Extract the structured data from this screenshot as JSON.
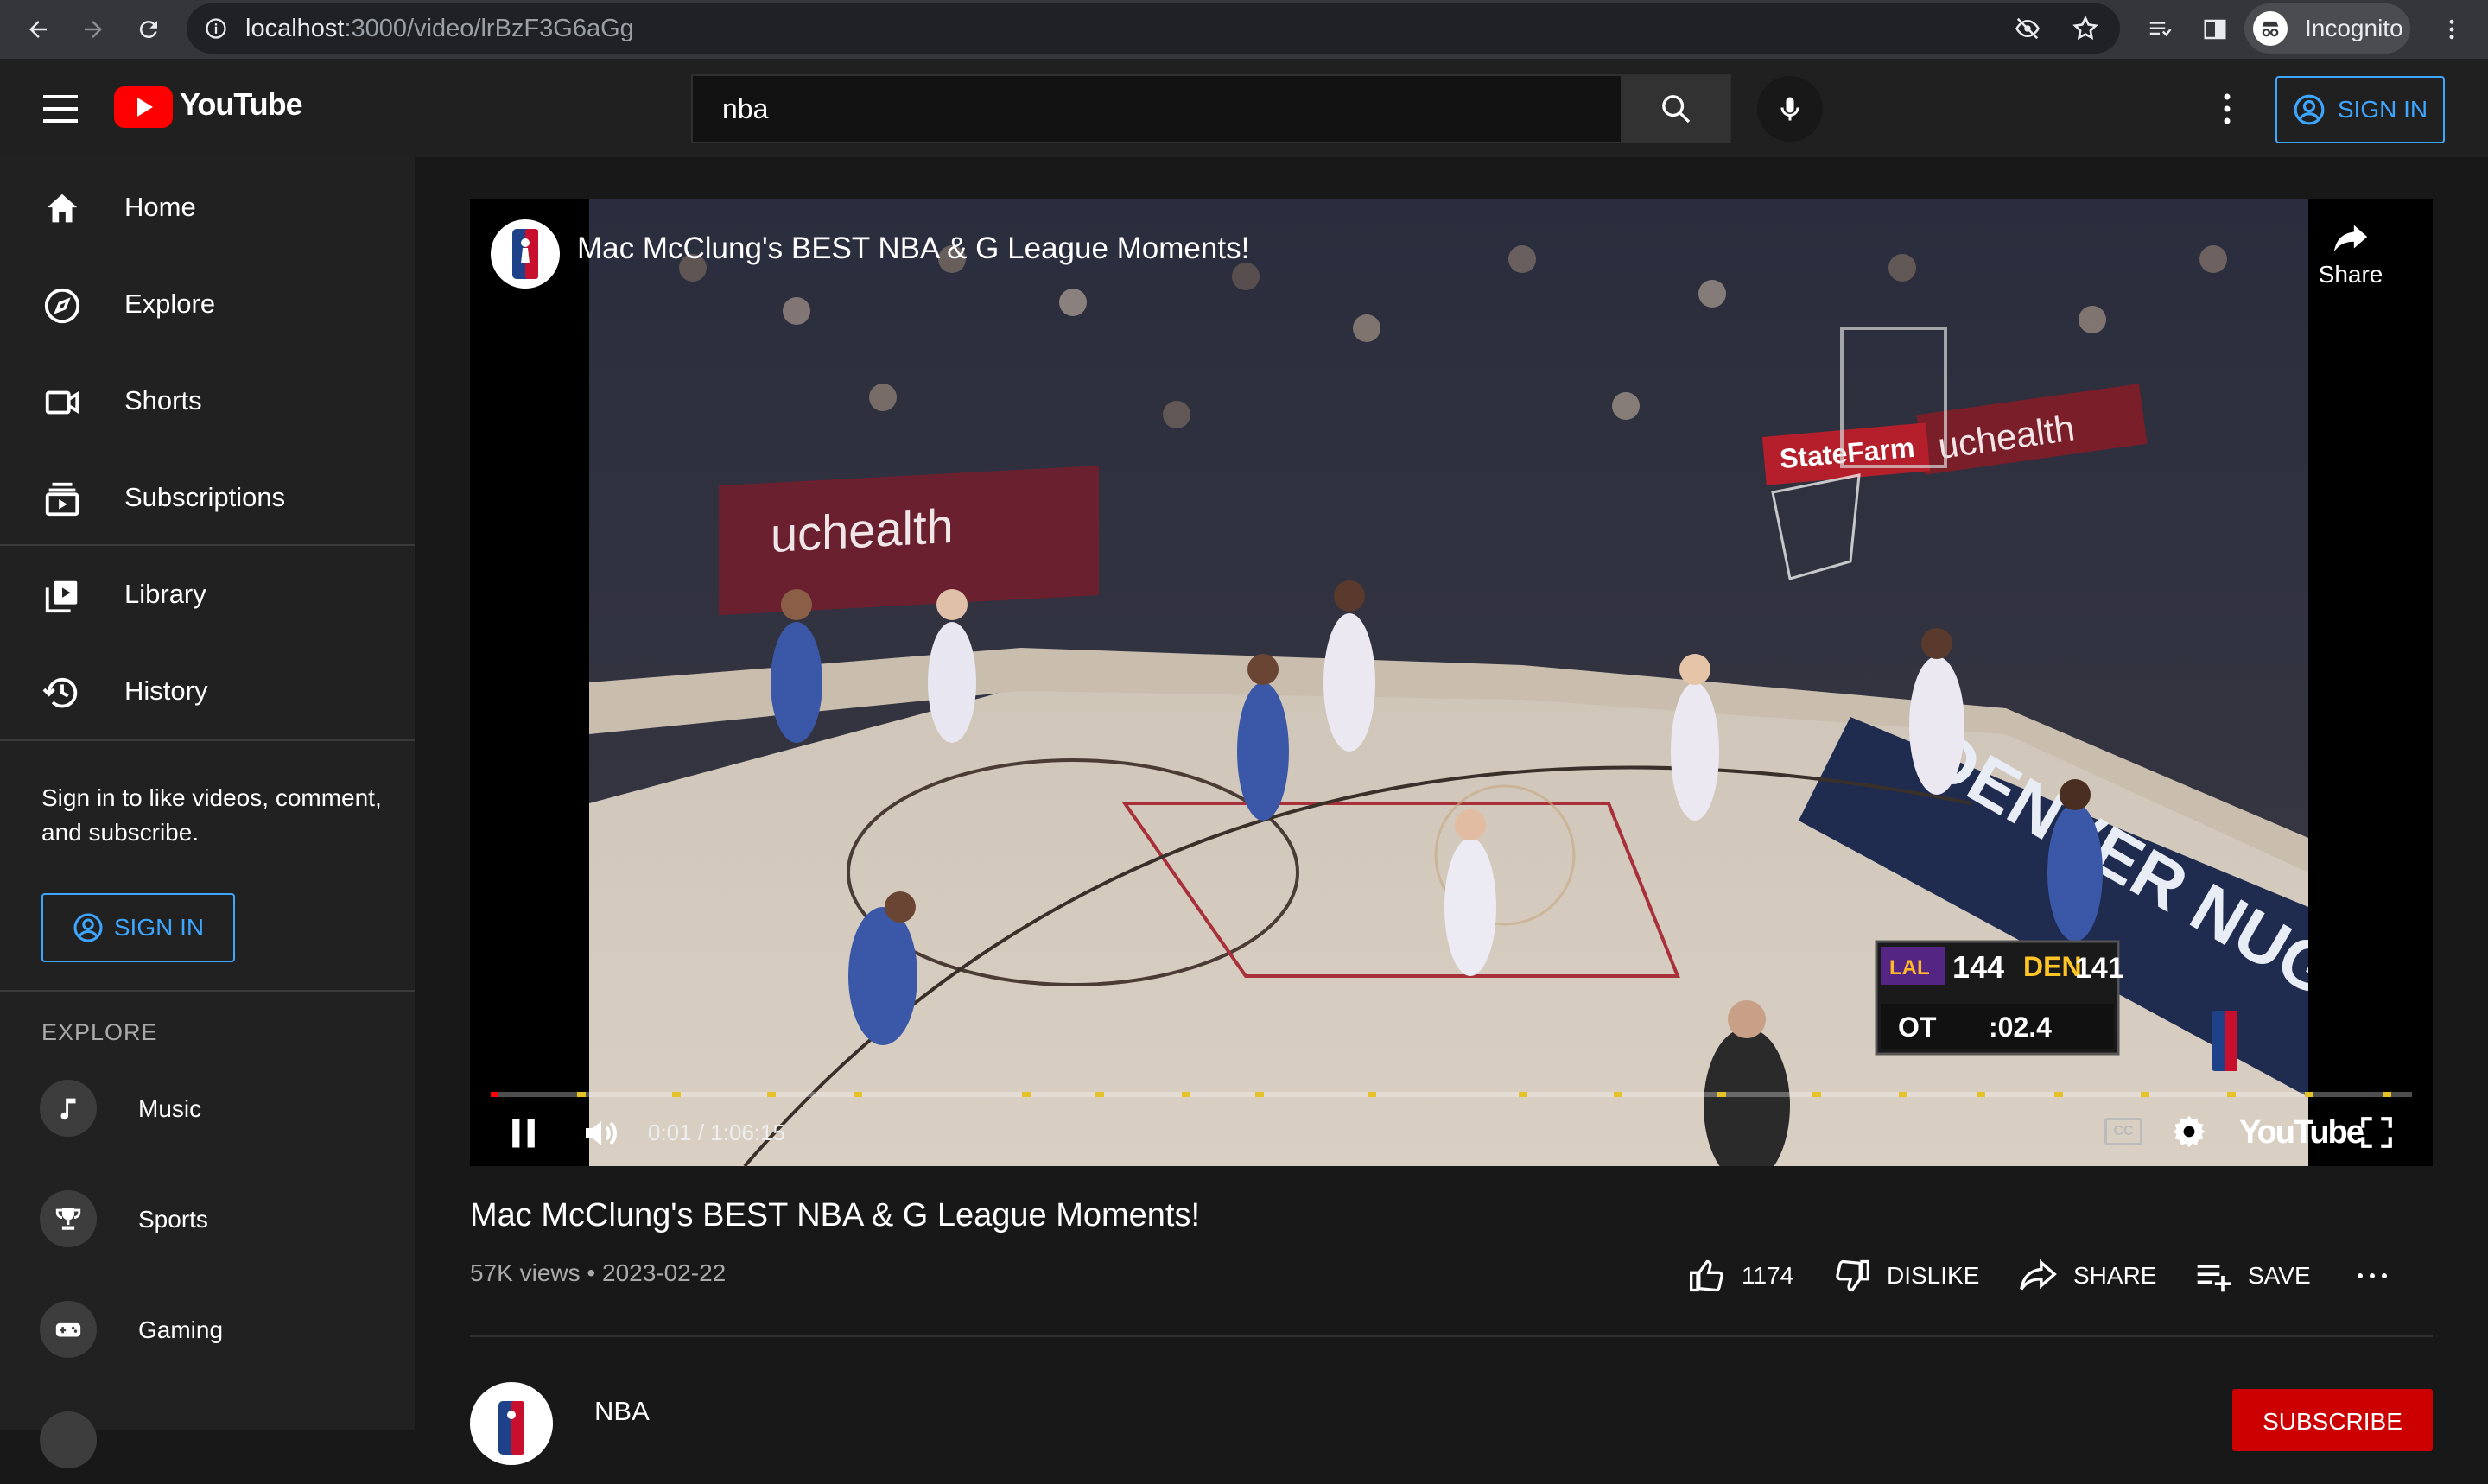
{
  "browser": {
    "url_host": "localhost",
    "url_path": ":3000/video/lrBzF3G6aGg",
    "profile_label": "Incognito"
  },
  "header": {
    "logo_text": "YouTube",
    "search_value": "nba",
    "signin_label": "SIGN IN"
  },
  "sidebar": {
    "items": [
      {
        "label": "Home",
        "icon": "home-icon"
      },
      {
        "label": "Explore",
        "icon": "compass-icon"
      },
      {
        "label": "Shorts",
        "icon": "shorts-icon"
      },
      {
        "label": "Subscriptions",
        "icon": "subscriptions-icon"
      },
      {
        "label": "Library",
        "icon": "library-icon"
      },
      {
        "label": "History",
        "icon": "history-icon"
      }
    ],
    "signin_message": "Sign in to like videos, comment, and subscribe.",
    "signin_label": "SIGN IN",
    "explore_heading": "EXPLORE",
    "explore_items": [
      {
        "label": "Music",
        "icon": "music-note-icon"
      },
      {
        "label": "Sports",
        "icon": "trophy-icon"
      },
      {
        "label": "Gaming",
        "icon": "gamepad-icon"
      }
    ]
  },
  "player": {
    "overlay_title": "Mac McClung's BEST NBA & G League Moments!",
    "share_label": "Share",
    "time_display": "0:01 / 1:06:15",
    "progress_fraction": 0.0003,
    "cc_label": "CC",
    "watermark": "YouTube",
    "scoreboard": {
      "team_a": "LAL",
      "score_a": "144",
      "team_b": "DEN",
      "score_b": "141",
      "period": "OT",
      "clock": ":02.4"
    },
    "arena_text": [
      "uchealth",
      "StateFarm",
      "DENVER NUGGETS"
    ],
    "accent_color": "#ff0000",
    "marker_color": "#e6c229"
  },
  "video": {
    "title": "Mac McClung's BEST NBA & G League Moments!",
    "views": "57K views",
    "date": "2023-02-22",
    "likes": "1174",
    "dislike_label": "DISLIKE",
    "share_label": "SHARE",
    "save_label": "SAVE"
  },
  "channel": {
    "name": "NBA",
    "subscribe_label": "SUBSCRIBE"
  },
  "colors": {
    "link_blue": "#3ea6ff",
    "subscribe_red": "#cc0000",
    "brand_red": "#ff0000"
  }
}
